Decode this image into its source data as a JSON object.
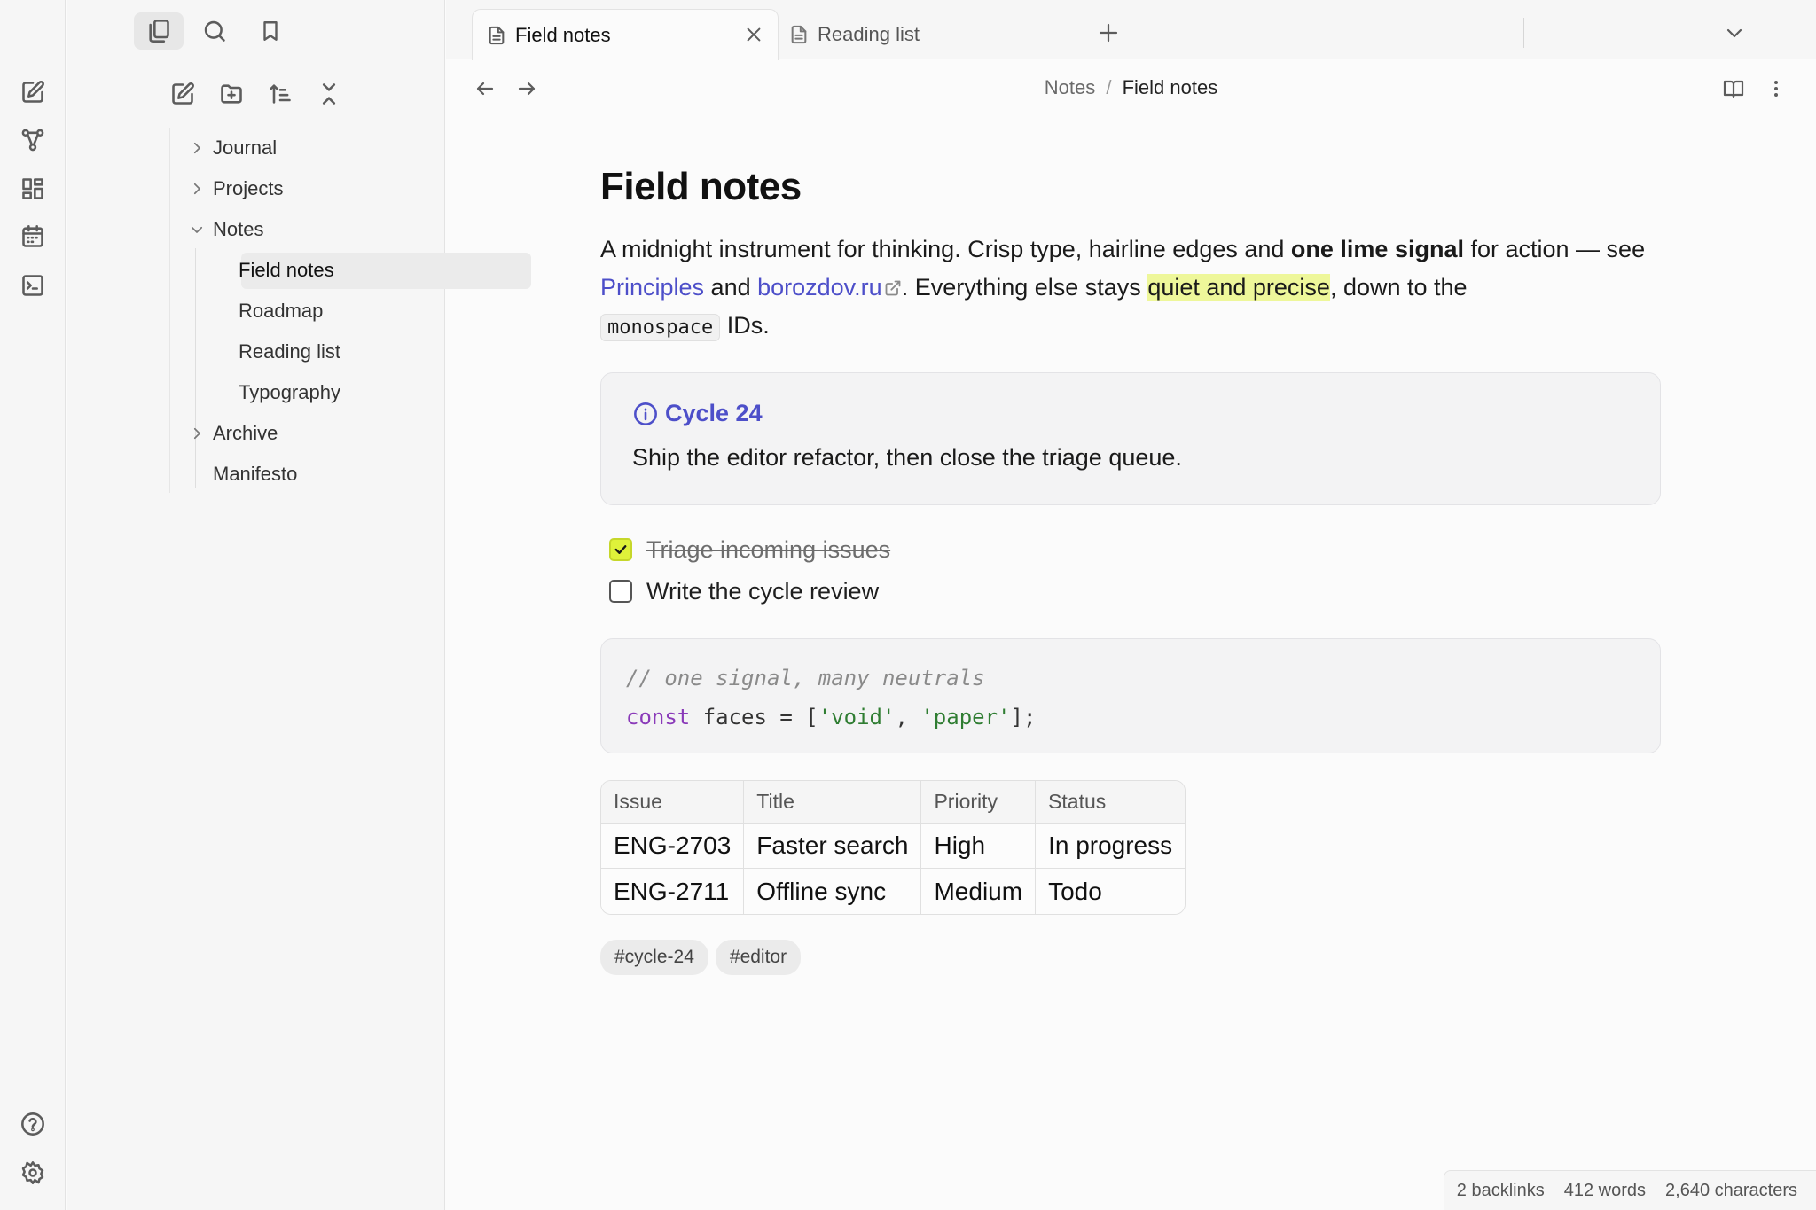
{
  "tabs": [
    {
      "label": "Field notes",
      "active": true
    },
    {
      "label": "Reading list",
      "active": false
    }
  ],
  "sidebar": {
    "tree": [
      {
        "label": "Journal",
        "type": "folder",
        "expanded": false
      },
      {
        "label": "Projects",
        "type": "folder",
        "expanded": false
      },
      {
        "label": "Notes",
        "type": "folder",
        "expanded": true
      },
      {
        "label": "Field notes",
        "type": "file",
        "active": true
      },
      {
        "label": "Roadmap",
        "type": "file"
      },
      {
        "label": "Reading list",
        "type": "file"
      },
      {
        "label": "Typography",
        "type": "file"
      },
      {
        "label": "Archive",
        "type": "folder",
        "expanded": false
      },
      {
        "label": "Manifesto",
        "type": "file"
      }
    ]
  },
  "breadcrumb": {
    "parent": "Notes",
    "separator": "/",
    "current": "Field notes"
  },
  "note": {
    "title": "Field notes",
    "paragraph": {
      "t1": "A midnight instrument for thinking. Crisp type, hairline edges and ",
      "bold": "one lime signal",
      "t2": " for action — see ",
      "link1": "Principles",
      "t3": " and ",
      "link2": "borozdov.ru",
      "t4": ". Everything else stays ",
      "highlight": "quiet and precise",
      "t5": ", down to the ",
      "code": "monospace",
      "t6": " IDs."
    },
    "callout": {
      "title": "Cycle 24",
      "body": "Ship the editor refactor, then close the triage queue."
    },
    "tasks": [
      {
        "label": "Triage incoming issues",
        "done": true
      },
      {
        "label": "Write the cycle review",
        "done": false
      }
    ],
    "code": {
      "comment": "// one signal, many neutrals",
      "kw": "const",
      "ident": " faces = [",
      "s1": "'void'",
      "comma": ", ",
      "s2": "'paper'",
      "end": "];"
    },
    "table": {
      "headers": [
        "Issue",
        "Title",
        "Priority",
        "Status"
      ],
      "rows": [
        [
          "ENG-2703",
          "Faster search",
          "High",
          "In progress"
        ],
        [
          "ENG-2711",
          "Offline sync",
          "Medium",
          "Todo"
        ]
      ]
    },
    "tags": [
      "#cycle-24",
      "#editor"
    ]
  },
  "status": {
    "backlinks": "2 backlinks",
    "words": "412 words",
    "chars": "2,640 characters"
  },
  "colors": {
    "accent": "#4d4fc9",
    "signal": "#dff23a",
    "highlight": "#eef79a"
  }
}
